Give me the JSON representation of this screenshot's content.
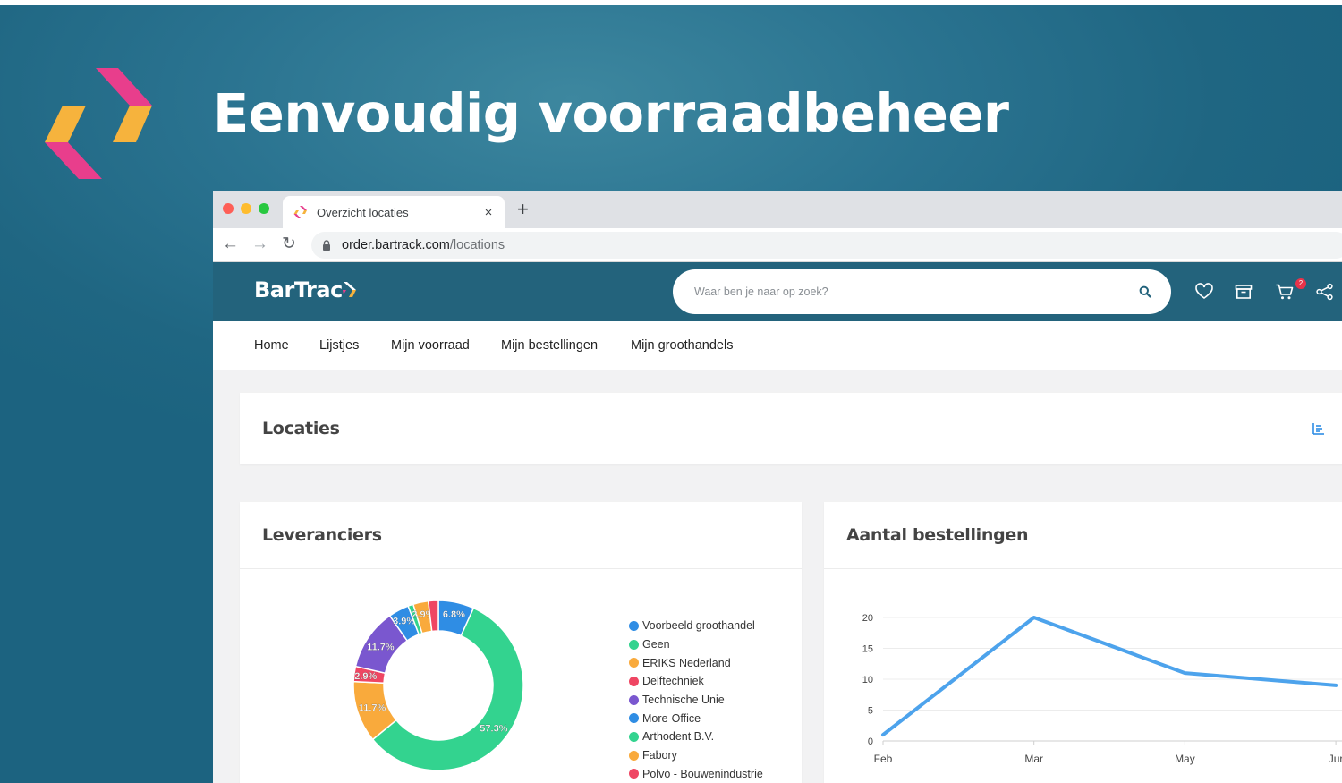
{
  "hero": {
    "title": "Eenvoudig voorraadbeheer"
  },
  "browser": {
    "tab_title": "Overzicht locaties",
    "tab_close": "×",
    "new_tab": "+",
    "url_host": "order.bartrack.com",
    "url_path": "/locations"
  },
  "app": {
    "logo_text": "BarTrac",
    "search_placeholder": "Waar ben je naar op zoek?",
    "cart_count": "2",
    "nav": [
      "Home",
      "Lijstjes",
      "Mijn voorraad",
      "Mijn bestellingen",
      "Mijn groothandels"
    ],
    "colors": {
      "header": "#23637c",
      "accent_pink": "#e83e8c",
      "accent_yellow": "#f6b33d"
    }
  },
  "locaties": {
    "title": "Locaties"
  },
  "leveranciers": {
    "title": "Leveranciers",
    "chart_data": {
      "type": "pie",
      "slices": [
        {
          "name": "Voorbeeld groothandel",
          "label": "6.8%",
          "value": 6.8,
          "color": "#2f8de4"
        },
        {
          "name": "Geen",
          "label": "57.3%",
          "value": 57.3,
          "color": "#33d38f"
        },
        {
          "name": "ERIKS Nederland",
          "label": "11.7%",
          "value": 11.7,
          "color": "#f9aa3c"
        },
        {
          "name": "Delftechniek",
          "label": "2.9%",
          "value": 2.9,
          "color": "#ef4663"
        },
        {
          "name": "Technische Unie",
          "label": "11.7%",
          "value": 11.7,
          "color": "#7a57cf"
        },
        {
          "name": "More-Office",
          "label": "3.9%",
          "value": 3.9,
          "color": "#2f8de4"
        },
        {
          "name": "Arthodent B.V.",
          "label": "",
          "value": 1.0,
          "color": "#33d38f"
        },
        {
          "name": "Fabory",
          "label": "2.9%",
          "value": 2.9,
          "color": "#f9aa3c"
        },
        {
          "name": "Polvo - Bouwenindustrie",
          "label": "",
          "value": 1.9,
          "color": "#ef4663"
        }
      ]
    }
  },
  "bestellingen": {
    "title": "Aantal bestellingen",
    "chart_data": {
      "type": "line",
      "x": [
        "Feb",
        "Mar",
        "May",
        "Jun"
      ],
      "x_labels": [
        "Feb",
        "Mar",
        "May",
        "Jur"
      ],
      "series": [
        {
          "values": [
            1,
            20,
            11,
            9
          ],
          "color": "#4da3ec"
        }
      ],
      "y_ticks": [
        "0",
        "5",
        "10",
        "15",
        "20"
      ],
      "ylim": [
        0,
        20
      ],
      "grid": true
    }
  }
}
